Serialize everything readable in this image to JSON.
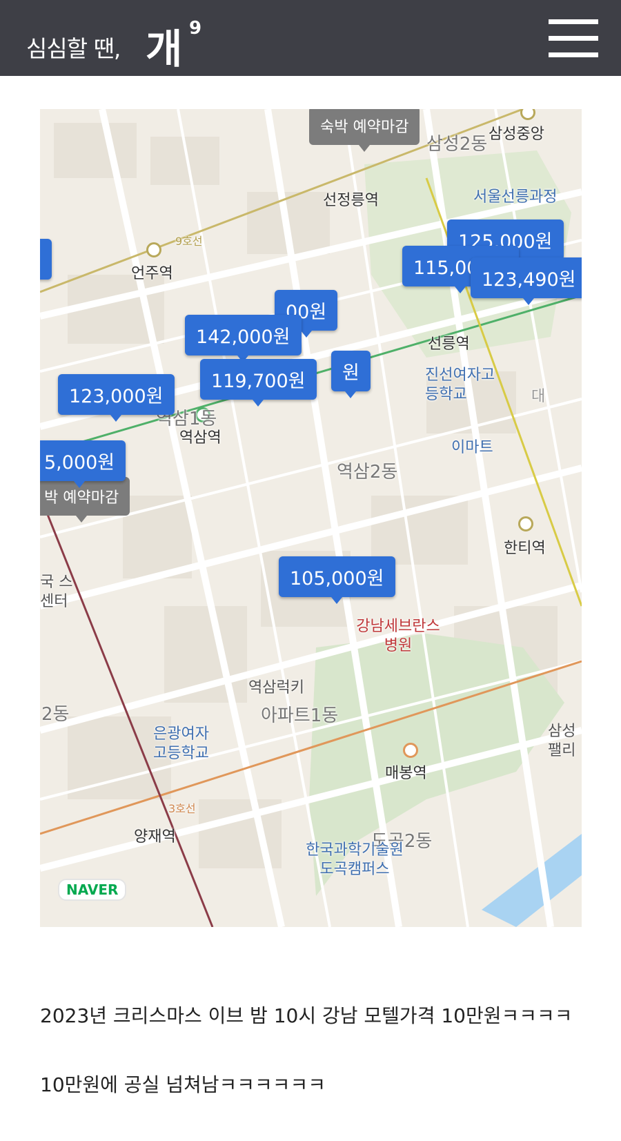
{
  "header": {
    "logo_text": "심심할 땐,",
    "logo_mark": "개",
    "logo_sup": "9",
    "bg_color": "#3e3f46"
  },
  "map": {
    "provider": "NAVER",
    "price_pin_color": "#2f6fd6",
    "closed_pin_color": "#7c7c7c",
    "closed_label": "숙박 예약마감",
    "closed_label_2": "박 예약마감",
    "stations": {
      "seonjeongneung": "선정릉역",
      "samseong_jungang": "삼성중앙",
      "eonju": "언주역",
      "seolleung": "선릉역",
      "yeoksam": "역삼역",
      "hanti": "한티역",
      "maebong": "매봉역",
      "yangjae": "양재역"
    },
    "dongs": {
      "samseong2": "삼성2동",
      "yeoksam1": "역삼1동",
      "yeoksam2": "역삼2동",
      "dogok2": "도곡2동",
      "left2": "2동",
      "apt1": "아파트1동"
    },
    "pois": {
      "seolleung_park": "서울선릉과정",
      "jinseon": "진선여자고등학교",
      "emart": "이마트",
      "severance": "강남세브란스병원",
      "yeoksam_lucky": "역삼럭키",
      "eungwang": "은광여자고등학교",
      "kaist": "한국과학기술원 도곡캠퍼스",
      "dae": "대",
      "samsung_palace": "삼성 팰리",
      "left_center": "국 스센터"
    },
    "line_labels": {
      "line9": "9호선",
      "line3": "3호선"
    },
    "prices": [
      "125,000원",
      "115,000원",
      "123,490원",
      "00원",
      "142,000원",
      "원",
      "119,700원",
      "123,000원",
      "5,000원",
      "105,000원",
      "원"
    ]
  },
  "post": {
    "line1": "2023년 크리스마스 이브 밤 10시 강남 모텔가격 10만원ㅋㅋㅋㅋ",
    "line2": "10만원에 공실 넘쳐남ㅋㅋㅋㅋㅋㅋ"
  }
}
